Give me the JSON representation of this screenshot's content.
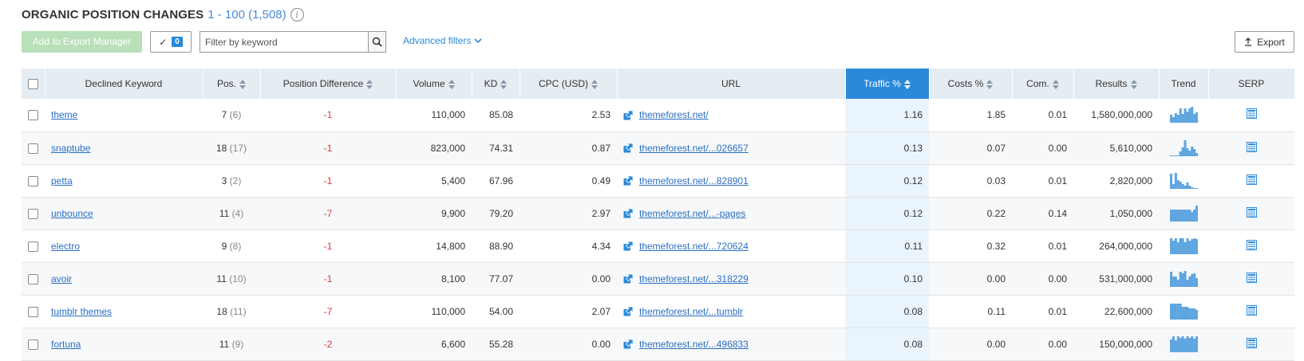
{
  "header": {
    "title": "ORGANIC POSITION CHANGES",
    "range": "1 - 100 (1,508)",
    "info_icon": "info-icon"
  },
  "toolbar": {
    "add_to_export_label": "Add to Export Manager",
    "selected_count": "0",
    "filter_placeholder": "Filter by keyword",
    "advanced_filters_label": "Advanced filters",
    "export_label": "Export"
  },
  "colors": {
    "accent": "#2a8ad9",
    "header_bg": "#e5ecf2",
    "negative": "#d43c3c",
    "link": "#2a6fc0",
    "trend_bar": "#5fa5e0"
  },
  "table": {
    "columns": [
      "Declined Keyword",
      "Pos.",
      "Position Difference",
      "Volume",
      "KD",
      "CPC (USD)",
      "URL",
      "Traffic %",
      "Costs %",
      "Com.",
      "Results",
      "Trend",
      "SERP"
    ],
    "active_sort_column": "Traffic %",
    "rows": [
      {
        "keyword": "theme",
        "pos": "7",
        "prev_pos": "(6)",
        "diff": "-1",
        "volume": "110,000",
        "kd": "85.08",
        "cpc": "2.53",
        "url": "themeforest.net/",
        "traffic": "1.16",
        "costs": "1.85",
        "com": "0.01",
        "results": "1,580,000,000",
        "trend": [
          0.5,
          0.35,
          0.6,
          0.5,
          0.9,
          0.55,
          0.9,
          0.7,
          0.9,
          1.0,
          0.55,
          0.65
        ]
      },
      {
        "keyword": "snaptube",
        "pos": "18",
        "prev_pos": "(17)",
        "diff": "-1",
        "volume": "823,000",
        "kd": "74.31",
        "cpc": "0.87",
        "url": "themeforest.net/...026657",
        "traffic": "0.13",
        "costs": "0.07",
        "com": "0.00",
        "results": "5,610,000",
        "trend": [
          0.0,
          0.05,
          0.05,
          0.05,
          0.3,
          0.55,
          1.0,
          0.5,
          0.35,
          0.6,
          0.45,
          0.2
        ]
      },
      {
        "keyword": "petta",
        "pos": "3",
        "prev_pos": "(2)",
        "diff": "-1",
        "volume": "5,400",
        "kd": "67.96",
        "cpc": "0.49",
        "url": "themeforest.net/...828901",
        "traffic": "0.12",
        "costs": "0.03",
        "com": "0.01",
        "results": "2,820,000",
        "trend": [
          0.95,
          0.3,
          1.0,
          0.55,
          0.45,
          0.3,
          0.2,
          0.4,
          0.2,
          0.1,
          0.0,
          0.0
        ]
      },
      {
        "keyword": "unbounce",
        "pos": "11",
        "prev_pos": "(4)",
        "diff": "-7",
        "volume": "9,900",
        "kd": "79.20",
        "cpc": "2.97",
        "url": "themeforest.net/...-pages",
        "traffic": "0.12",
        "costs": "0.22",
        "com": "0.14",
        "results": "1,050,000",
        "trend": [
          0.75,
          0.75,
          0.75,
          0.75,
          0.75,
          0.75,
          0.75,
          0.75,
          0.75,
          0.6,
          0.75,
          1.0
        ]
      },
      {
        "keyword": "electro",
        "pos": "9",
        "prev_pos": "(8)",
        "diff": "-1",
        "volume": "14,800",
        "kd": "88.90",
        "cpc": "4.34",
        "url": "themeforest.net/...720624",
        "traffic": "0.11",
        "costs": "0.32",
        "com": "0.01",
        "results": "264,000,000",
        "trend": [
          1.0,
          0.85,
          1.0,
          0.75,
          1.0,
          1.0,
          0.75,
          1.0,
          0.85,
          0.95,
          1.0,
          0.95
        ]
      },
      {
        "keyword": "avoir",
        "pos": "11",
        "prev_pos": "(10)",
        "diff": "-1",
        "volume": "8,100",
        "kd": "77.07",
        "cpc": "0.00",
        "url": "themeforest.net/...318229",
        "traffic": "0.10",
        "costs": "0.00",
        "com": "0.00",
        "results": "531,000,000",
        "trend": [
          0.95,
          0.65,
          0.65,
          0.45,
          0.95,
          0.85,
          1.0,
          0.45,
          0.65,
          0.8,
          0.85,
          0.55
        ]
      },
      {
        "keyword": "tumblr themes",
        "pos": "18",
        "prev_pos": "(11)",
        "diff": "-7",
        "volume": "110,000",
        "kd": "54.00",
        "cpc": "2.07",
        "url": "themeforest.net/...tumblr",
        "traffic": "0.08",
        "costs": "0.11",
        "com": "0.01",
        "results": "22,600,000",
        "trend": [
          1.0,
          1.0,
          1.0,
          1.0,
          1.0,
          0.8,
          0.8,
          0.8,
          0.7,
          0.7,
          0.7,
          0.6
        ]
      },
      {
        "keyword": "fortuna",
        "pos": "11",
        "prev_pos": "(9)",
        "diff": "-2",
        "volume": "6,600",
        "kd": "55.28",
        "cpc": "0.00",
        "url": "themeforest.net/...496833",
        "traffic": "0.08",
        "costs": "0.00",
        "com": "0.00",
        "results": "150,000,000",
        "trend": [
          0.8,
          1.0,
          0.75,
          1.0,
          0.9,
          1.0,
          0.85,
          1.0,
          0.9,
          1.0,
          0.85,
          1.0
        ]
      }
    ]
  }
}
